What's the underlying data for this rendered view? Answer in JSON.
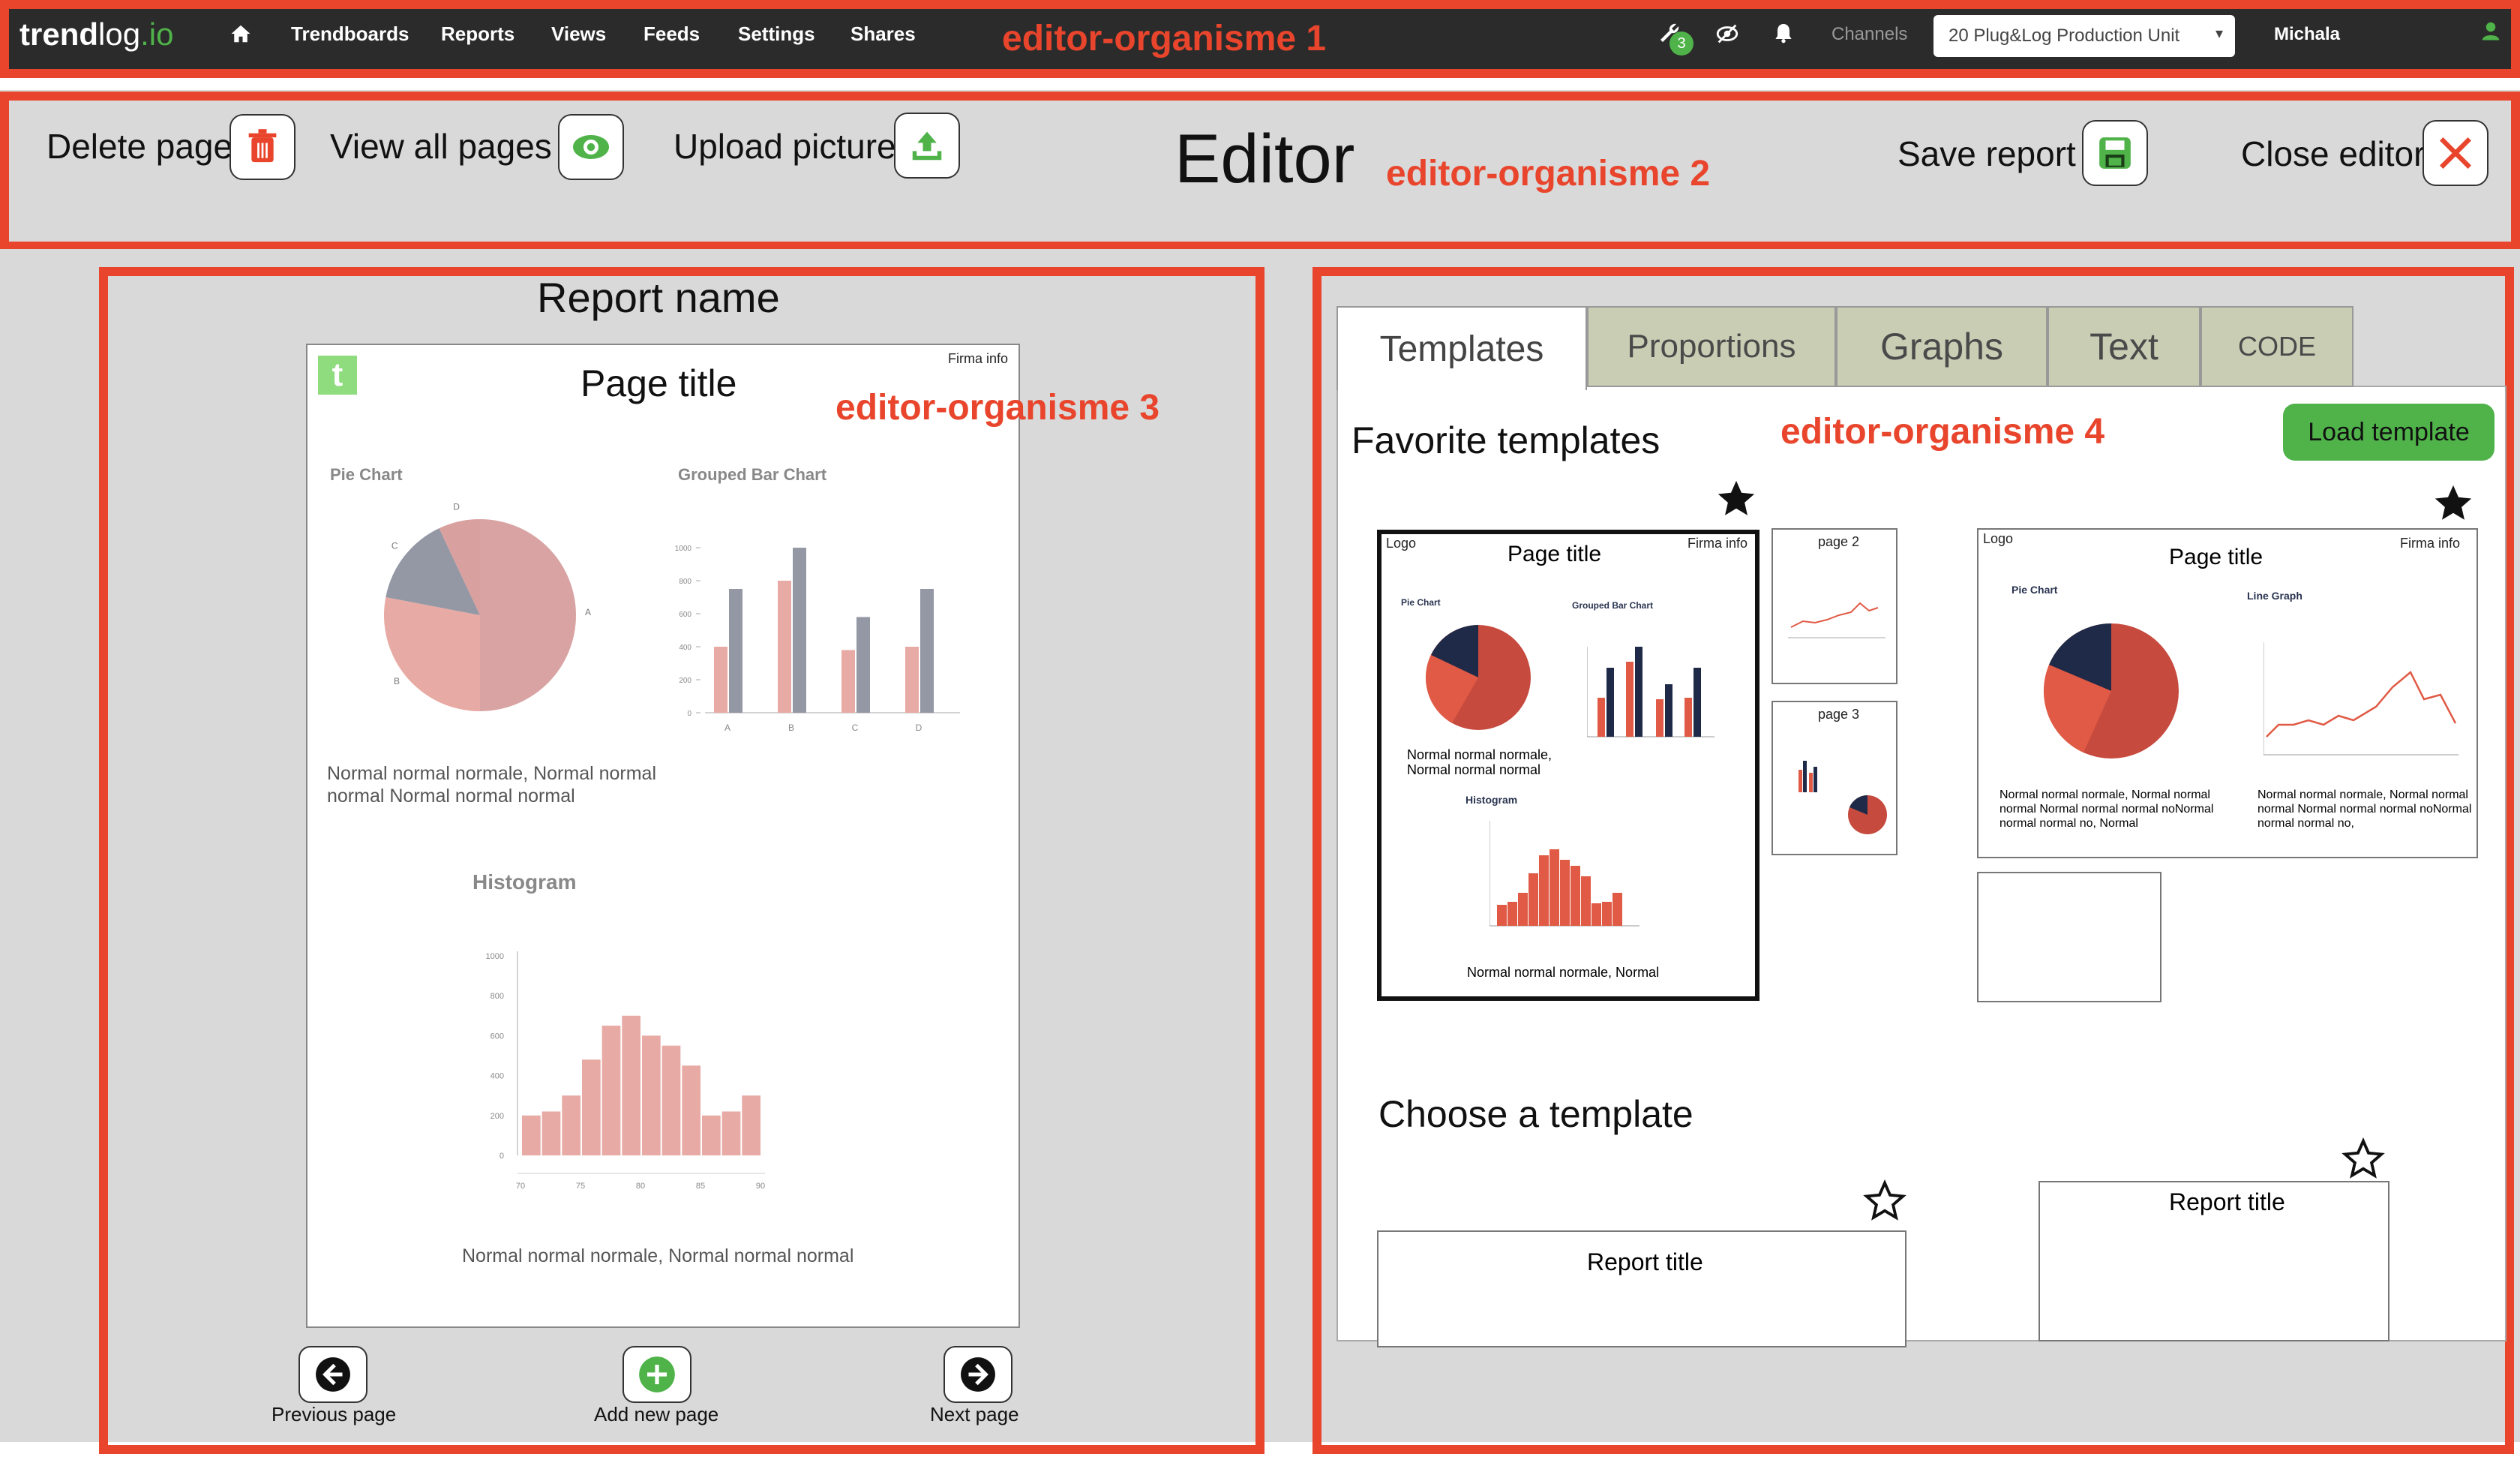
{
  "nav": {
    "logo_bold": "trend",
    "logo_light": "log",
    "logo_tld": ".io",
    "links": [
      "Trendboards",
      "Reports",
      "Views",
      "Feeds",
      "Settings",
      "Shares"
    ],
    "badge_count": "3",
    "channels_label": "Channels",
    "channel_select": "20 Plug&Log Production Unit",
    "user": "Michala"
  },
  "annotations": {
    "org1": "editor-organisme 1",
    "org2": "editor-organisme 2",
    "org3": "editor-organisme 3",
    "org4": "editor-organisme 4"
  },
  "toolbar": {
    "delete_label": "Delete page",
    "view_all_label": "View all pages",
    "upload_label": "Upload picture",
    "title": "Editor",
    "save_label": "Save report",
    "close_label": "Close editor"
  },
  "report": {
    "name": "Report name",
    "page_title": "Page title",
    "firma": "Firma info",
    "logo_letter": "t",
    "pie_title": "Pie Chart",
    "bar_title": "Grouped Bar Chart",
    "hist_title": "Histogram",
    "pie_text": "Normal normal normale, Normal normal normal Normal normal normal",
    "hist_text": "Normal normal normale, Normal normal normal",
    "prev_label": "Previous page",
    "add_label": "Add new page",
    "next_label": "Next page"
  },
  "chart_data": [
    {
      "type": "pie",
      "title": "Pie Chart",
      "categories": [
        "A",
        "B",
        "C",
        "D"
      ],
      "values": [
        50,
        28,
        15,
        7
      ],
      "colors": [
        "#d9a3a3",
        "#e8aaa4",
        "#9497a4",
        "#d8a09e"
      ]
    },
    {
      "type": "bar",
      "title": "Grouped Bar Chart",
      "categories": [
        "A",
        "B",
        "C",
        "D"
      ],
      "series": [
        {
          "values": [
            400,
            800,
            380,
            400
          ],
          "color": "#e8aaa4"
        },
        {
          "values": [
            750,
            1000,
            580,
            750
          ],
          "color": "#9497a4"
        }
      ],
      "ylim": [
        0,
        1000
      ],
      "yticks": [
        0,
        200,
        400,
        600,
        800,
        1000
      ]
    },
    {
      "type": "bar",
      "title": "Histogram",
      "x": [
        70,
        75,
        80,
        85,
        90
      ],
      "values": [
        200,
        220,
        300,
        480,
        650,
        700,
        600,
        550,
        450,
        200,
        220,
        300
      ],
      "ylim": [
        0,
        1000
      ],
      "yticks": [
        0,
        200,
        400,
        600,
        800,
        1000
      ],
      "color": "#e8aaa4"
    }
  ],
  "panel": {
    "tabs": [
      "Templates",
      "Proportions",
      "Graphs",
      "Text",
      "CODE"
    ],
    "favorites_title": "Favorite templates",
    "load_button": "Load template",
    "choose_title": "Choose a template",
    "tpl_logo": "Logo",
    "tpl_page_title": "Page title",
    "tpl_firma": "Firma info",
    "tpl_pie": "Pie Chart",
    "tpl_bar": "Grouped Bar Chart",
    "tpl_hist": "Histogram",
    "tpl_line": "Line Graph",
    "tpl_text1": "Normal normal normale, Normal normal normal",
    "tpl_text2": "Normal normal normale, Normal",
    "tpl_text3": "Normal normal normale, Normal normal normal Normal normal normal noNormal normal normal no, Normal",
    "tpl_text4": "Normal normal normale, Normal normal normal Normal normal normal noNormal normal normal no,",
    "page2": "page 2",
    "page3": "page 3",
    "report_title_1": "Report title",
    "report_title_2": "Report title"
  },
  "colors": {
    "accent_green": "#4fb34a",
    "annotation_red": "#e8452c",
    "nav_bg": "#2b2b2b",
    "tab_bg": "#c9cdb4"
  }
}
